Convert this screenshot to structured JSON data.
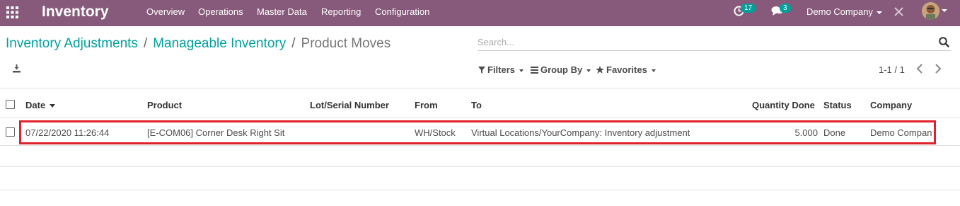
{
  "navbar": {
    "app_title": "Inventory",
    "menu": [
      "Overview",
      "Operations",
      "Master Data",
      "Reporting",
      "Configuration"
    ],
    "activity_badge": "17",
    "messages_badge": "3",
    "company": "Demo Company",
    "icons": {
      "apps": "apps-grid-icon",
      "activity": "clock-icon",
      "messages": "chat-icon",
      "debug": "bug-icon"
    },
    "color": "#875a7b"
  },
  "breadcrumb": {
    "items": [
      "Inventory Adjustments",
      "Manageable Inventory"
    ],
    "current": "Product Moves",
    "separator": "/"
  },
  "search": {
    "placeholder": "Search..."
  },
  "filters": {
    "filters_label": "Filters",
    "group_by_label": "Group By",
    "favorites_label": "Favorites"
  },
  "pager": {
    "value": "1-1 / 1"
  },
  "table": {
    "columns": [
      "Date",
      "Product",
      "Lot/Serial Number",
      "From",
      "To",
      "Quantity Done",
      "Status",
      "Company"
    ],
    "rows": [
      {
        "date": "07/22/2020 11:26:44",
        "product": "[E-COM06] Corner Desk Right Sit",
        "lot": "",
        "from": "WH/Stock",
        "to": "Virtual Locations/YourCompany: Inventory adjustment",
        "quantity": "5.000",
        "status": "Done",
        "company": "Demo Company"
      }
    ]
  },
  "colors": {
    "accent": "#00a09d",
    "highlight": "#e0202a"
  }
}
